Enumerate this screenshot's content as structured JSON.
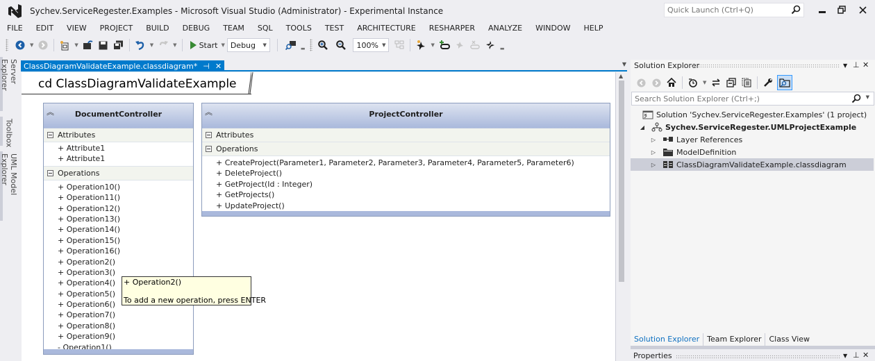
{
  "window": {
    "title": "Sychev.ServiceRegester.Examples - Microsoft Visual Studio (Administrator) - Experimental Instance",
    "quick_launch_placeholder": "Quick Launch (Ctrl+Q)",
    "accent_color": "#007acc"
  },
  "menu": {
    "items": [
      "FILE",
      "EDIT",
      "VIEW",
      "PROJECT",
      "BUILD",
      "DEBUG",
      "TEAM",
      "SQL",
      "TOOLS",
      "TEST",
      "ARCHITECTURE",
      "RESHARPER",
      "ANALYZE",
      "WINDOW",
      "HELP"
    ]
  },
  "toolbar": {
    "start_label": "Start",
    "configuration": "Debug",
    "zoom_level": "100%"
  },
  "left_tool_tabs": [
    "Server Explorer",
    "Toolbox",
    "UML Model Explorer"
  ],
  "document": {
    "tab_label": "ClassDiagramValidateExample.classdiagram*",
    "frame_title": "cd ClassDiagramValidateExample"
  },
  "diagram": {
    "classes": [
      {
        "name": "DocumentController",
        "attributes_label": "Attributes",
        "attributes": [
          "+ Attribute1",
          "+ Attribute1"
        ],
        "operations_label": "Operations",
        "operations": [
          "+ Operation10()",
          "+ Operation11()",
          "+ Operation12()",
          "+ Operation13()",
          "+ Operation14()",
          "+ Operation15()",
          "+ Operation16()",
          "+ Operation2()",
          "+ Operation3()",
          "+ Operation4()",
          "+ Operation5()",
          "+ Operation6()",
          "+ Operation7()",
          "+ Operation8()",
          "+ Operation9()",
          "- Operation1()"
        ]
      },
      {
        "name": "ProjectController",
        "attributes_label": "Attributes",
        "attributes": [],
        "operations_label": "Operations",
        "operations": [
          "+ CreateProject(Parameter1, Parameter2, Parameter3, Parameter4, Parameter5, Parameter6)",
          "+ DeleteProject()",
          "+ GetProject(Id : Integer)",
          "+ GetProjects()",
          "+ UpdateProject()"
        ]
      }
    ],
    "tooltip": {
      "line1": "+ Operation2()",
      "line2": "To add a new operation, press ENTER"
    }
  },
  "solution_explorer": {
    "title": "Solution Explorer",
    "search_placeholder": "Search Solution Explorer (Ctrl+;)",
    "tree": [
      {
        "label": "Solution 'Sychev.ServiceRegester.Examples' (1 project)",
        "icon": "solution-icon",
        "level": 0,
        "expander": "",
        "bold": false,
        "selected": false
      },
      {
        "label": "Sychev.ServiceRegester.UMLProjectExample",
        "icon": "modeling-project-icon",
        "level": 1,
        "expander": "expanded",
        "bold": true,
        "selected": false
      },
      {
        "label": "Layer References",
        "icon": "layer-references-icon",
        "level": 2,
        "expander": "collapsed",
        "bold": false,
        "selected": false
      },
      {
        "label": "ModelDefinition",
        "icon": "folder-icon",
        "level": 2,
        "expander": "collapsed",
        "bold": false,
        "selected": false
      },
      {
        "label": "ClassDiagramValidateExample.classdiagram",
        "icon": "class-diagram-icon",
        "level": 2,
        "expander": "collapsed",
        "bold": false,
        "selected": true
      }
    ],
    "bottom_tabs": [
      "Solution Explorer",
      "Team Explorer",
      "Class View"
    ],
    "active_bottom_tab": 0
  },
  "properties": {
    "title": "Properties"
  }
}
